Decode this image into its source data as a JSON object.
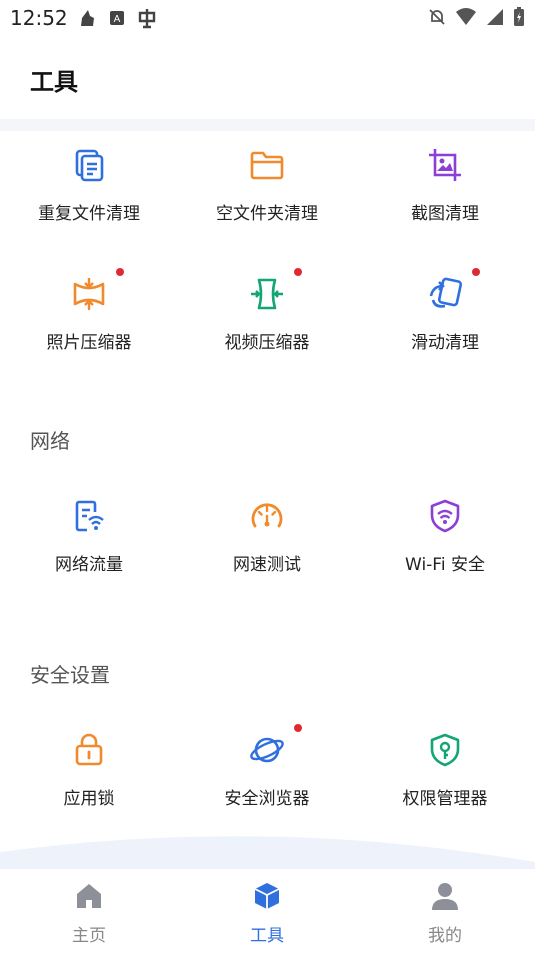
{
  "status_bar": {
    "time": "12:52"
  },
  "header": {
    "title": "工具"
  },
  "sections": {
    "clean": {
      "items": [
        {
          "label": "重复文件清理"
        },
        {
          "label": "空文件夹清理"
        },
        {
          "label": "截图清理"
        },
        {
          "label": "照片压缩器"
        },
        {
          "label": "视频压缩器"
        },
        {
          "label": "滑动清理"
        }
      ]
    },
    "network": {
      "title": "网络",
      "items": [
        {
          "label": "网络流量"
        },
        {
          "label": "网速测试"
        },
        {
          "label": "Wi-Fi 安全"
        }
      ]
    },
    "security": {
      "title": "安全设置",
      "items": [
        {
          "label": "应用锁"
        },
        {
          "label": "安全浏览器"
        },
        {
          "label": "权限管理器"
        }
      ]
    }
  },
  "bottom_nav": {
    "items": [
      {
        "label": "主页"
      },
      {
        "label": "工具"
      },
      {
        "label": "我的"
      }
    ]
  },
  "colors": {
    "blue": "#2f6fde",
    "orange": "#f08a2c",
    "purple": "#8c3fd6",
    "green": "#13a573",
    "red_dot": "#e02a33"
  }
}
